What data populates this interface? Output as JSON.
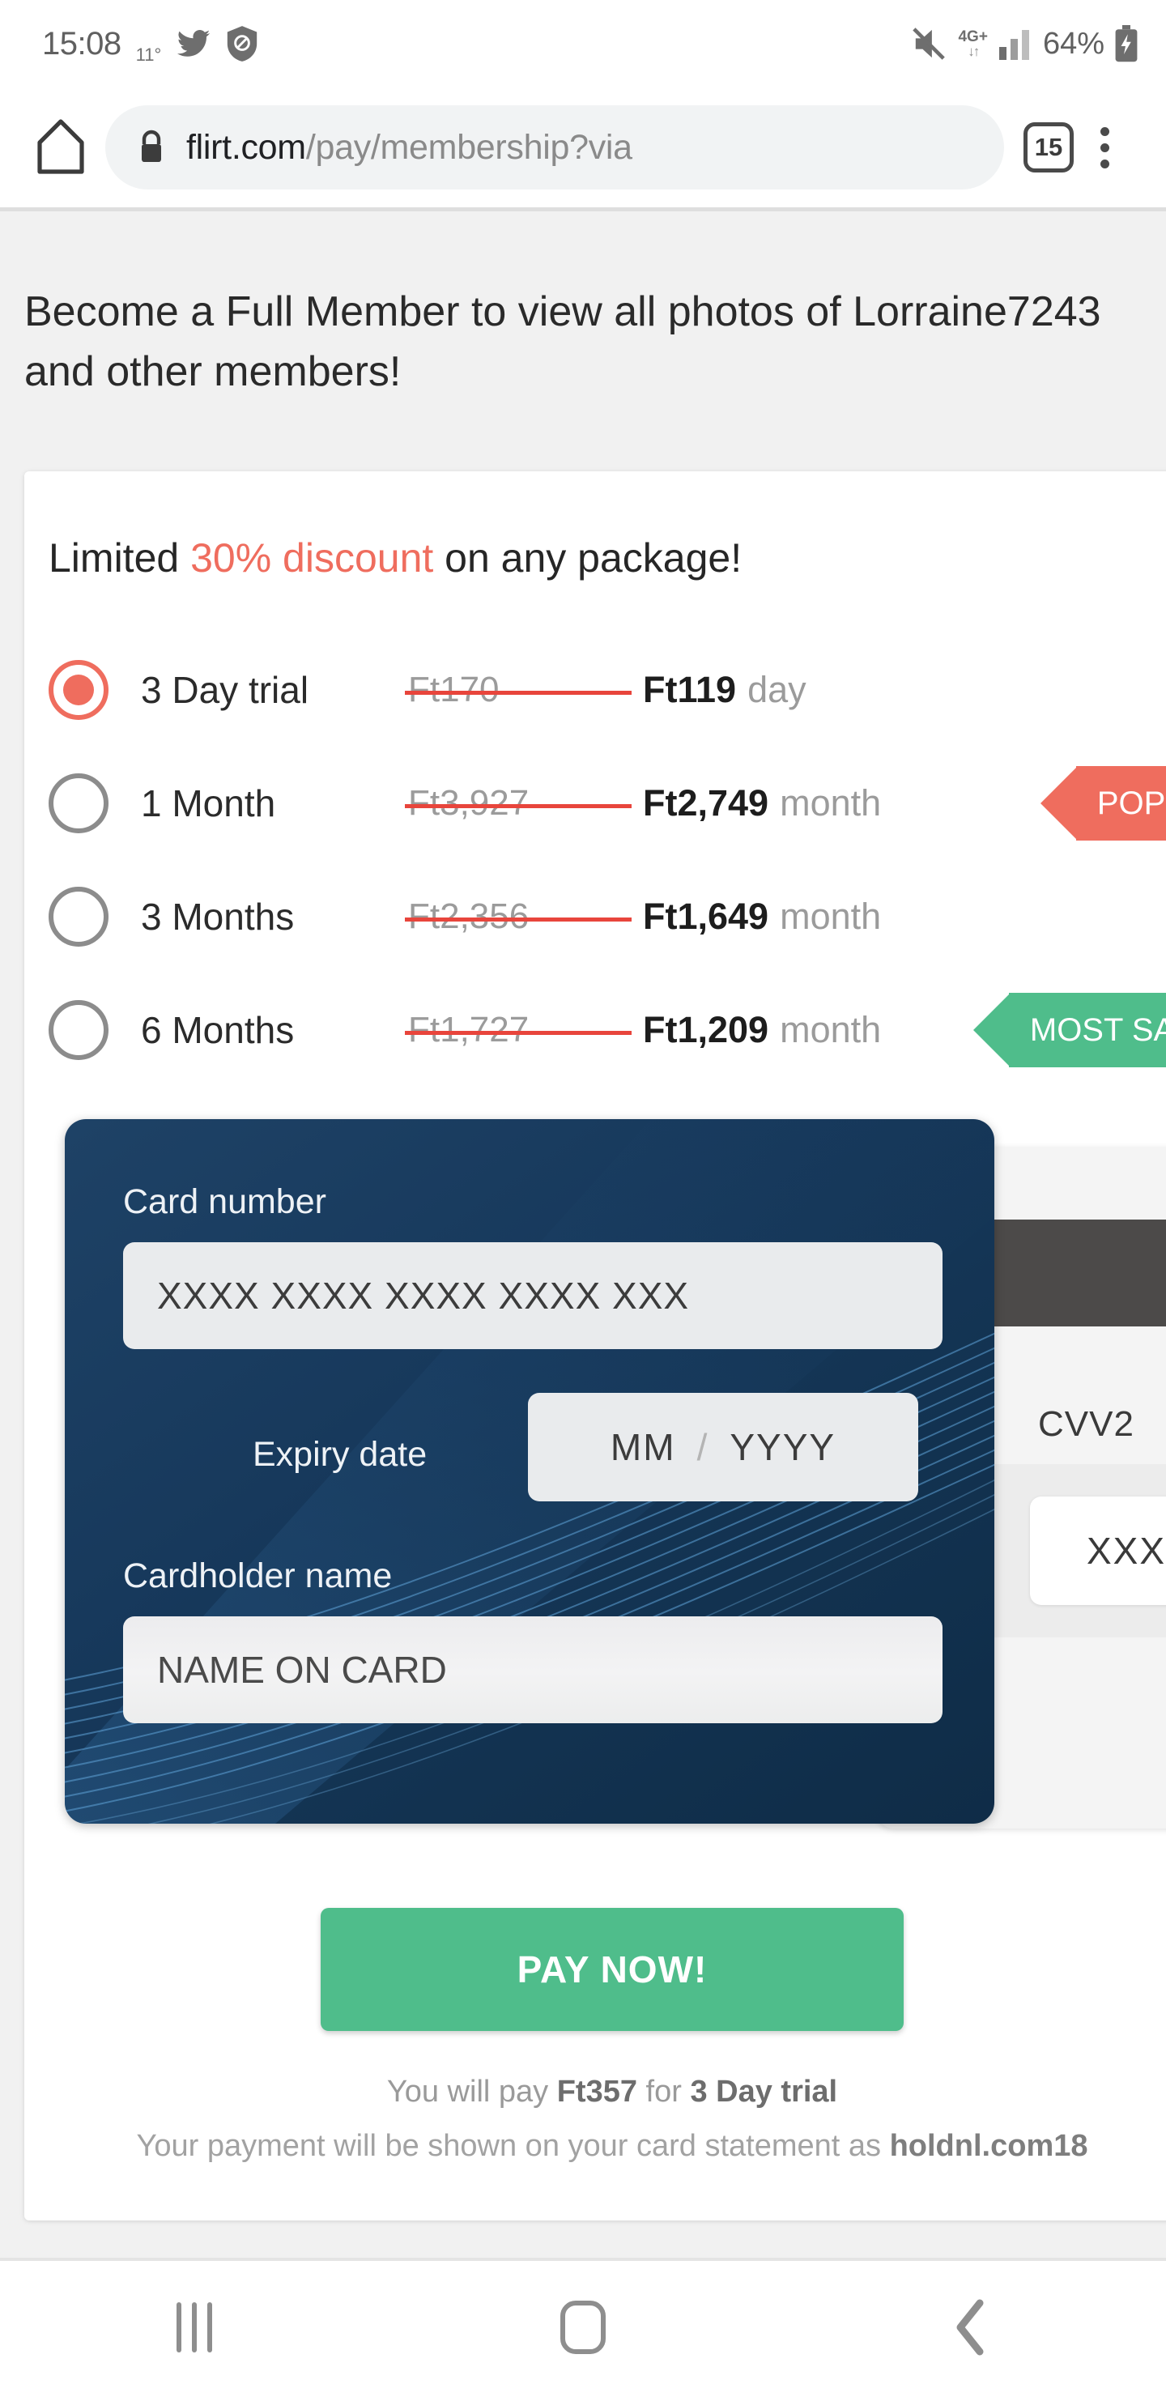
{
  "status_bar": {
    "time": "15:08",
    "temperature": "11°",
    "twitter_icon": "twitter-bird-icon",
    "block_icon": "shield-block-icon",
    "mute_icon": "volume-muted-icon",
    "network_type": "4G+",
    "network_arrows": "↓↑",
    "signal_icon": "signal-bars-icon",
    "battery_percent": "64%",
    "battery_icon": "battery-charging-icon"
  },
  "browser": {
    "home_icon": "home-icon",
    "lock_icon": "lock-icon",
    "url_host": "flirt.com",
    "url_path": "/pay/membership?via",
    "tab_count": "15",
    "menu_icon": "overflow-menu-icon"
  },
  "page": {
    "headline_line1": "Become a Full Member to view all photos of Lorraine7243",
    "headline_line2": "and other members!",
    "discount_prefix": "Limited ",
    "discount_highlight": "30% discount",
    "discount_suffix": " on any package!",
    "plans": [
      {
        "name": "3 Day trial",
        "old_price": "Ft170",
        "new_price": "Ft119",
        "period": "day",
        "selected": true,
        "ribbon": null
      },
      {
        "name": "1 Month",
        "old_price": "Ft3,927",
        "new_price": "Ft2,749",
        "period": "month",
        "selected": false,
        "ribbon": "POPULAR"
      },
      {
        "name": "3 Months",
        "old_price": "Ft2,356",
        "new_price": "Ft1,649",
        "period": "month",
        "selected": false,
        "ribbon": null
      },
      {
        "name": "6 Months",
        "old_price": "Ft1,727",
        "new_price": "Ft1,209",
        "period": "month",
        "selected": false,
        "ribbon": "MOST SAVING"
      }
    ],
    "card_form": {
      "card_number_label": "Card number",
      "card_number_placeholder": "XXXX XXXX XXXX XXXX XXX",
      "expiry_label": "Expiry date",
      "expiry_month_placeholder": "MM",
      "expiry_separator": "/",
      "expiry_year_placeholder": "YYYY",
      "cardholder_label": "Cardholder name",
      "cardholder_placeholder": "NAME ON CARD",
      "cvv_label": "CVV2",
      "cvv_placeholder": "XXX"
    },
    "pay_button": "PAY NOW!",
    "footer_pay_prefix": "You will pay ",
    "footer_pay_amount": "Ft357",
    "footer_pay_middle": " for ",
    "footer_pay_plan": "3 Day trial",
    "footer_statement_prefix": "Your payment will be shown on your card statement as ",
    "footer_statement_merchant": "holdnl.com18"
  },
  "nav_bar": {
    "recents_icon": "recents-icon",
    "home_icon": "home-square-icon",
    "back_icon": "back-chevron-icon"
  },
  "colors": {
    "accent_coral": "#ef6d5e",
    "accent_green": "#4fbd8b",
    "card_blue": "#17395c",
    "page_bg": "#f1f1f1"
  }
}
